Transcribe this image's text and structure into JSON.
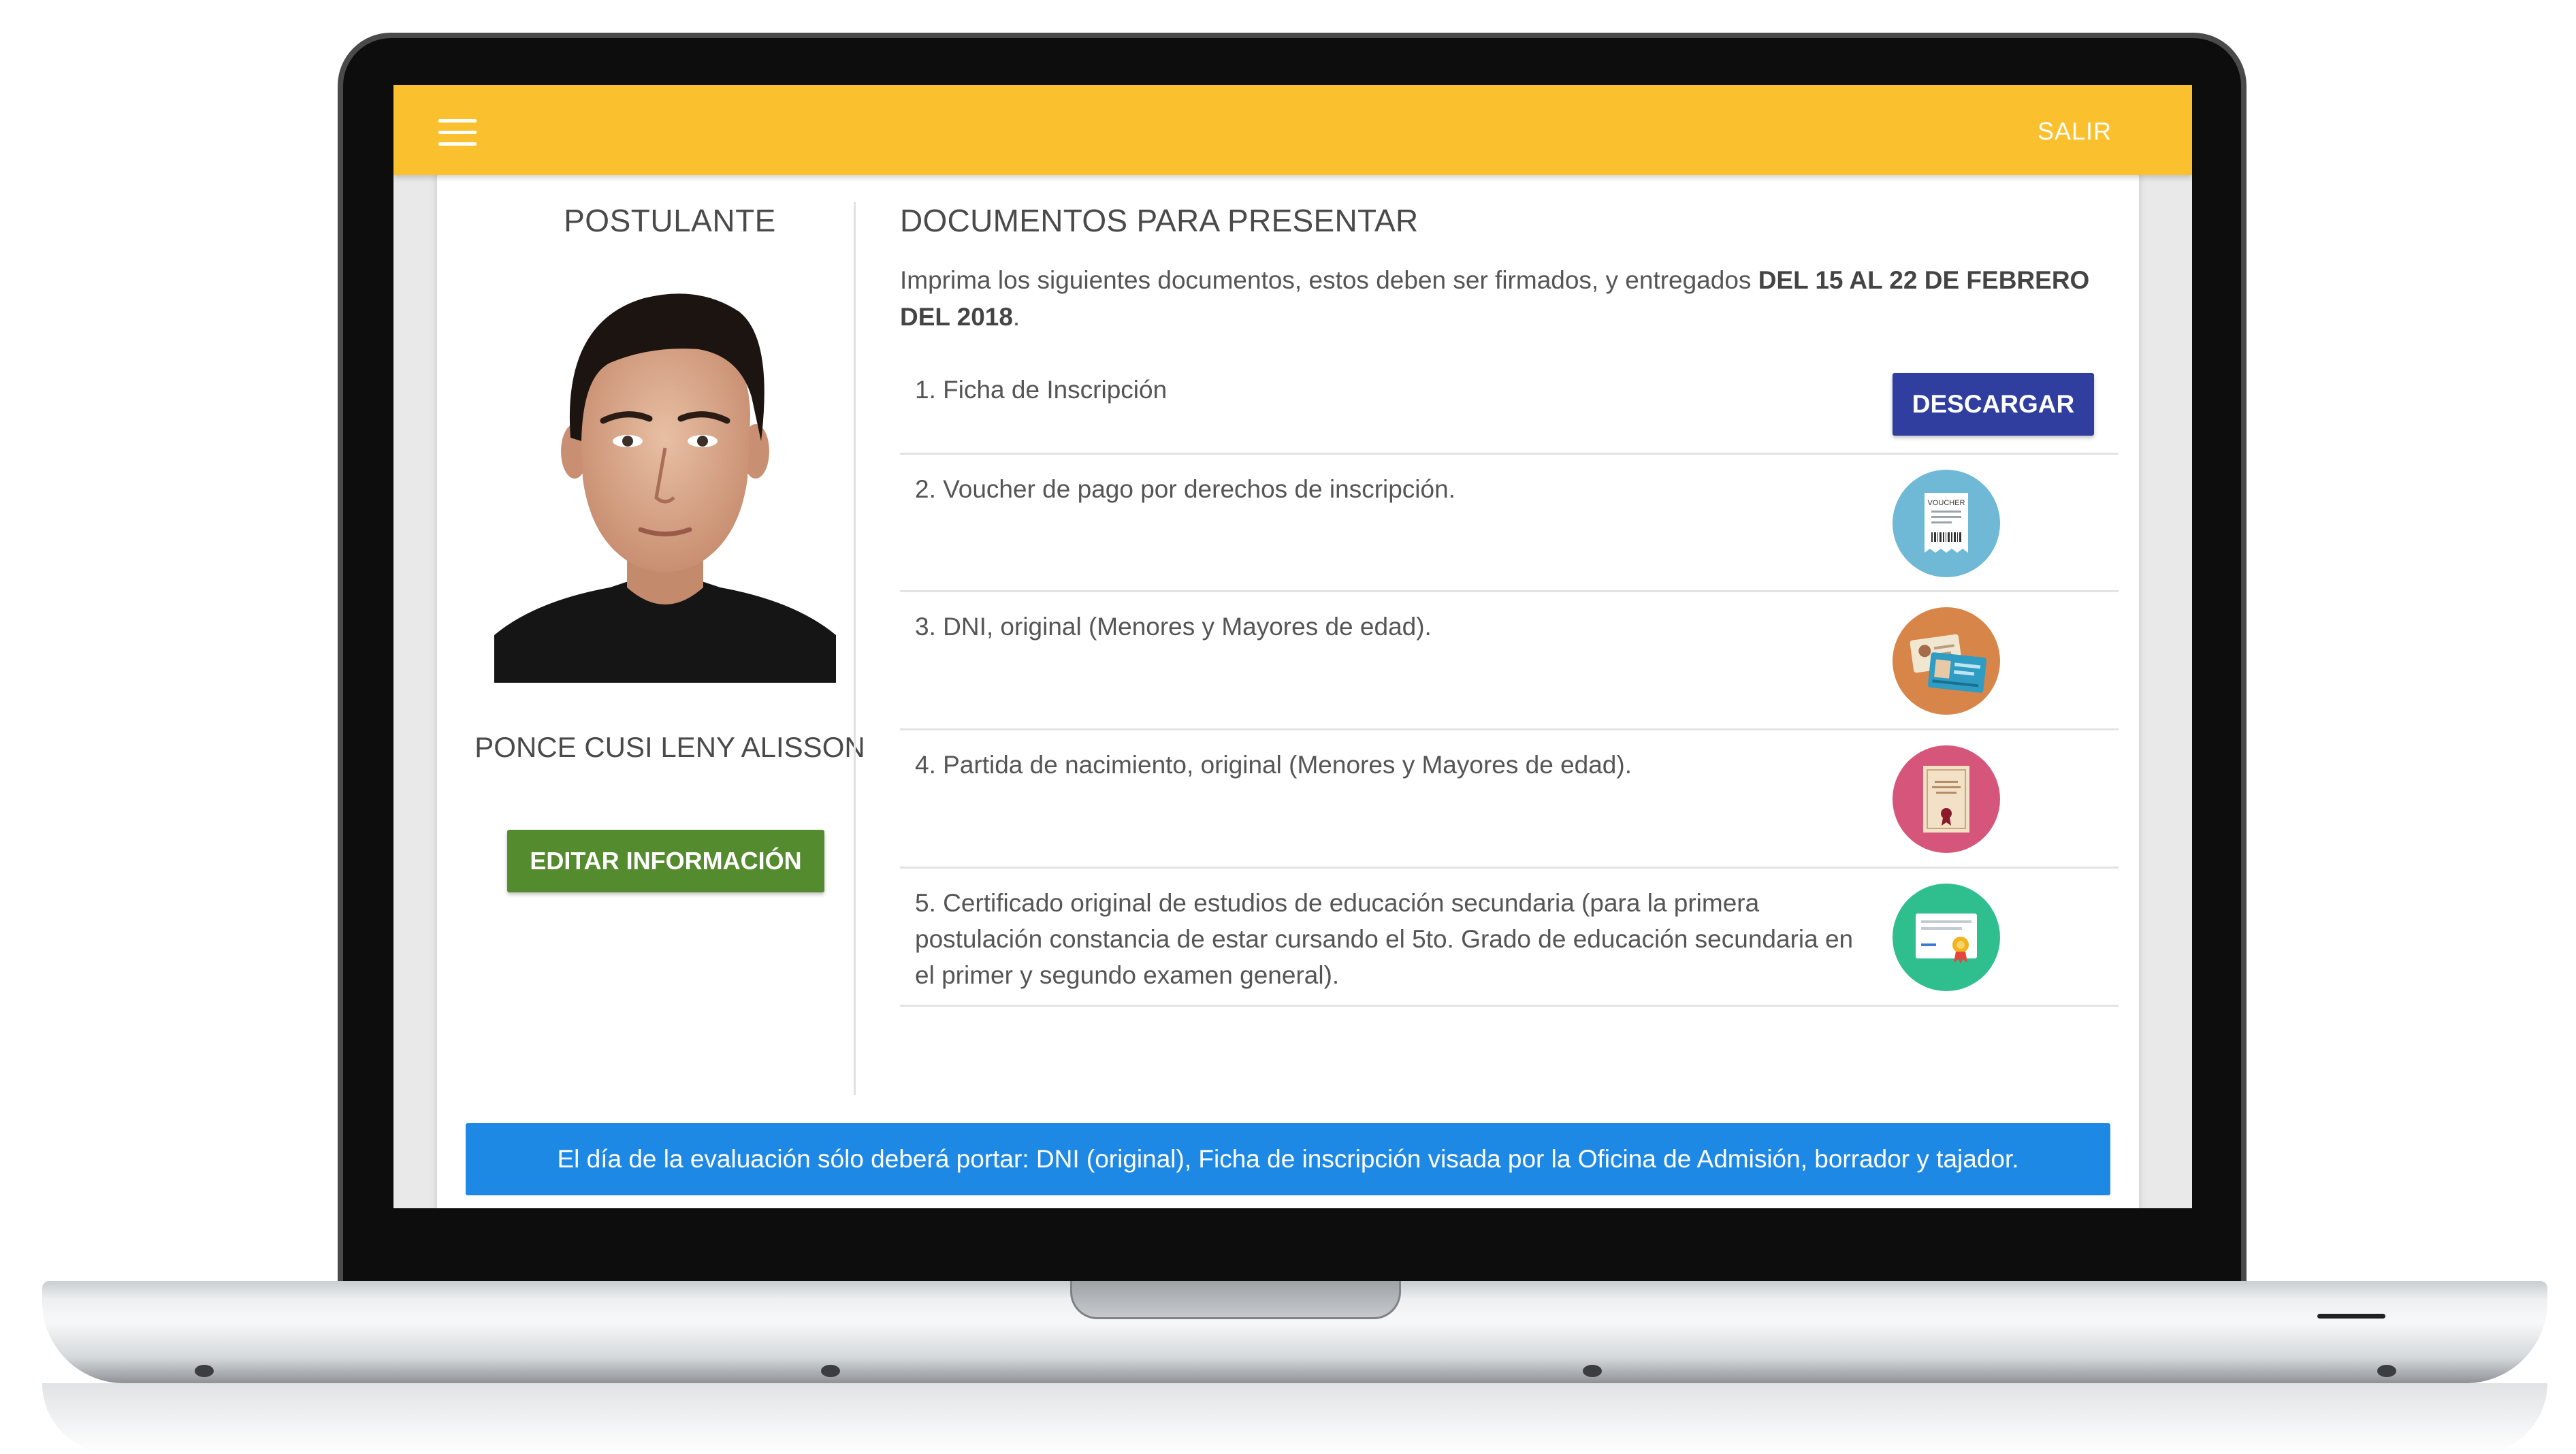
{
  "topbar": {
    "menu_icon": "hamburger-menu-icon",
    "logout_label": "SALIR",
    "color": "#fbc02d"
  },
  "applicant": {
    "section_title": "POSTULANTE",
    "name": "PONCE CUSI LENY ALISSON",
    "edit_button": "EDITAR INFORMACIÓN"
  },
  "documents": {
    "section_title": "DOCUMENTOS PARA PRESENTAR",
    "intro_prefix": "Imprima los siguientes documentos, estos deben ser firmados, y entregados ",
    "intro_dates": "DEL 15 AL 22 DE FEBRERO DEL 2018",
    "intro_suffix": ".",
    "items": [
      {
        "text": "1. Ficha de Inscripción",
        "action_label": "DESCARGAR"
      },
      {
        "text": "2. Voucher de pago por derechos de inscripción.",
        "icon": "voucher-icon",
        "icon_label": "VOUCHER"
      },
      {
        "text": "3. DNI, original (Menores y Mayores de edad).",
        "icon": "id-card-icon"
      },
      {
        "text": "4. Partida de nacimiento, original (Menores y Mayores de edad).",
        "icon": "birth-certificate-icon"
      },
      {
        "text": "5. Certificado original de estudios de educación secundaria (para la primera postulación constancia de estar cursando el 5to. Grado de educación secundaria en el primer y segundo examen general).",
        "icon": "certificate-icon"
      }
    ]
  },
  "notice": "El día de la evaluación sólo deberá portar: DNI (original), Ficha de inscripción visada por la Oficina de Admisión, borrador y tajador.",
  "colors": {
    "accent_yellow": "#fbc02d",
    "edit_green": "#558b2f",
    "download_blue": "#303f9f",
    "notice_blue": "#1e88e5"
  }
}
